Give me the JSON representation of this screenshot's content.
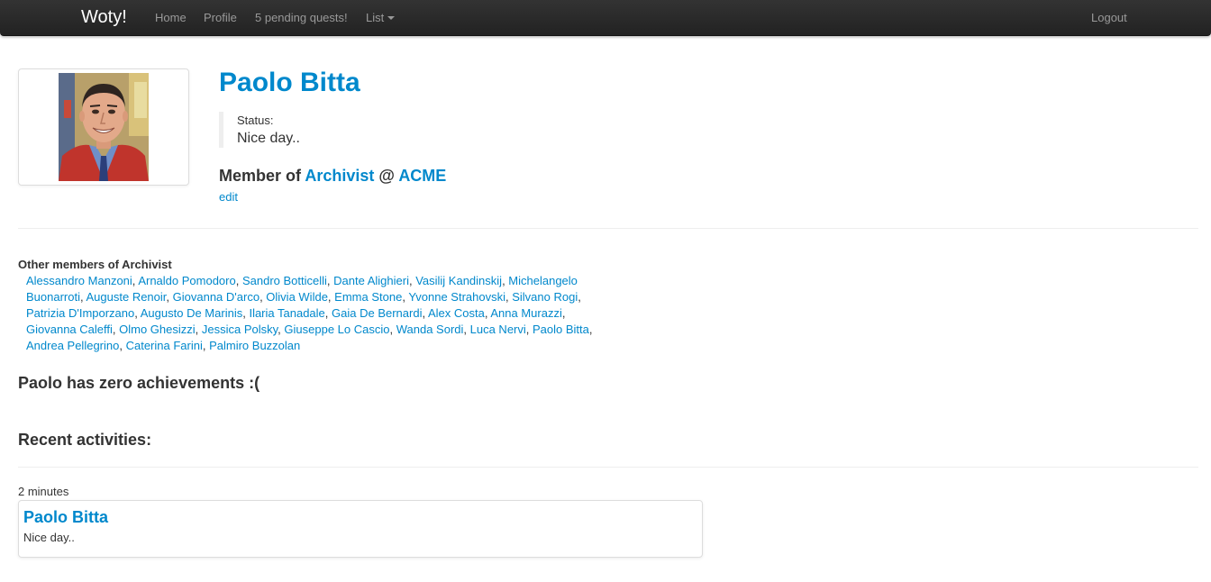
{
  "navbar": {
    "brand": "Woty!",
    "home": "Home",
    "profile": "Profile",
    "pending": "5 pending quests!",
    "list": "List",
    "logout": "Logout"
  },
  "profile": {
    "name": "Paolo Bitta",
    "status_label": "Status:",
    "status_text": "Nice day..",
    "member_prefix": "Member of",
    "group": "Archivist",
    "at": "@",
    "company": "ACME",
    "edit_label": "edit"
  },
  "others": {
    "title": "Other members of Archivist",
    "members": [
      "Alessandro Manzoni",
      "Arnaldo Pomodoro",
      "Sandro Botticelli",
      "Dante Alighieri",
      "Vasilij Kandinskij",
      "Michelangelo Buonarroti",
      "Auguste Renoir",
      "Giovanna D'arco",
      "Olivia Wilde",
      "Emma Stone",
      "Yvonne Strahovski",
      "Silvano Rogi",
      "Patrizia D'Imporzano",
      "Augusto De Marinis",
      "Ilaria Tanadale",
      "Gaia De Bernardi",
      "Alex Costa",
      "Anna Murazzi",
      "Giovanna Caleffi",
      "Olmo Ghesizzi",
      "Jessica Polsky",
      "Giuseppe Lo Cascio",
      "Wanda Sordi",
      "Luca Nervi",
      "Paolo Bitta",
      "Andrea Pellegrino",
      "Caterina Farini",
      "Palmiro Buzzolan"
    ]
  },
  "achievements": {
    "text": "Paolo has zero achievements :("
  },
  "recent": {
    "title": "Recent activities:",
    "items": [
      {
        "time": "2 minutes",
        "name": "Paolo Bitta",
        "text": "Nice day.."
      }
    ]
  },
  "colors": {
    "link": "#0088cc",
    "navbar": "#222222",
    "text": "#333333"
  }
}
